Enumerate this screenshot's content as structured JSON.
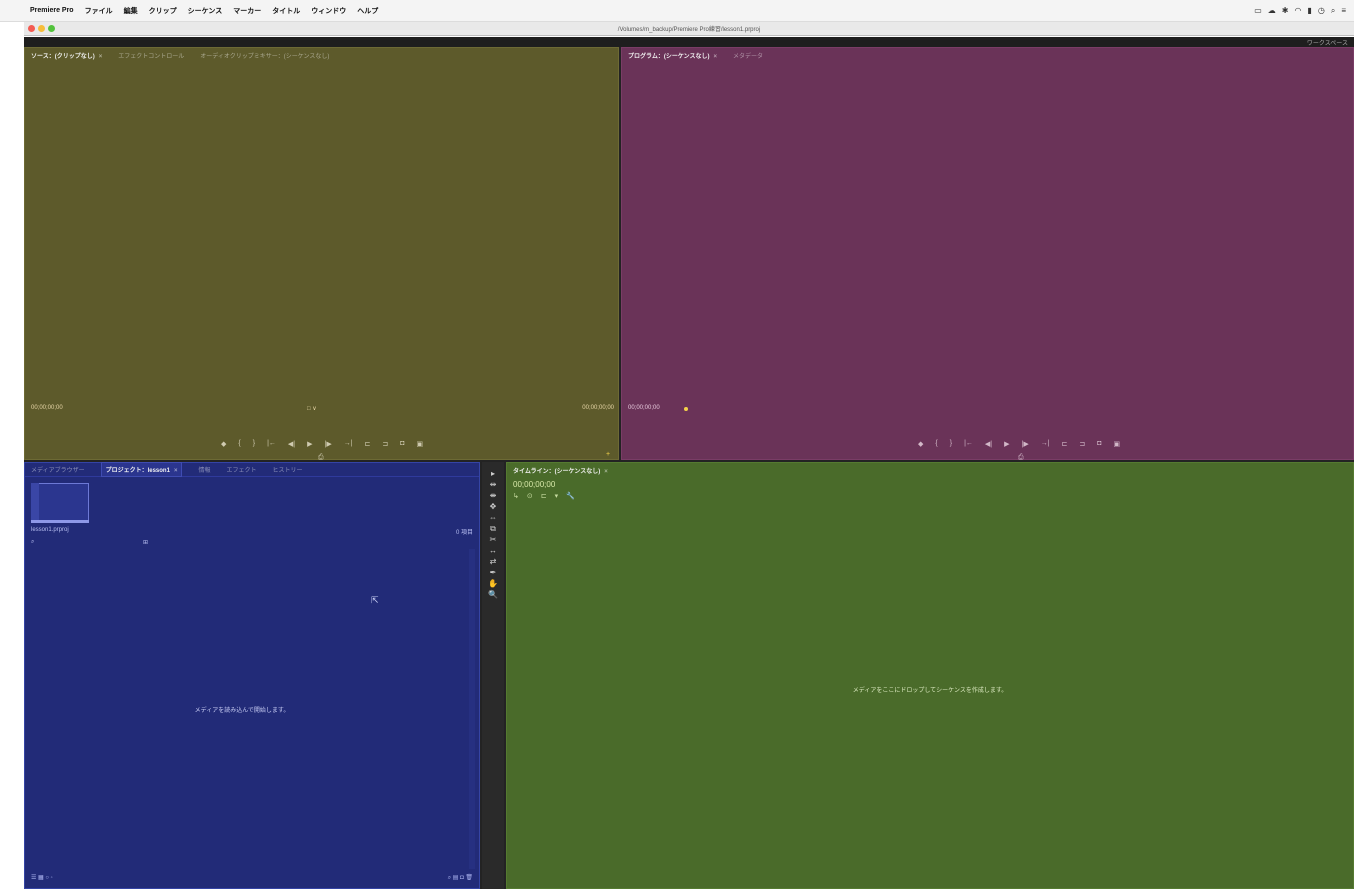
{
  "menubar": {
    "apple": "",
    "app_name": "Premiere Pro",
    "items": [
      "ファイル",
      "編集",
      "クリップ",
      "シーケンス",
      "マーカー",
      "タイトル",
      "ウィンドウ",
      "ヘルプ"
    ],
    "status_icons": [
      "display-icon",
      "cloud-icon",
      "bluetooth-icon",
      "wifi-icon",
      "battery-icon",
      "clock-icon",
      "search-icon",
      "list-icon"
    ]
  },
  "window": {
    "title_path": "/Volumes/m_backup/Premiere Pro練習/lesson1.prproj",
    "workspace_label": "ワークスペース"
  },
  "source_monitor": {
    "tabs": [
      "ソース：(クリップなし)",
      "エフェクトコントロール",
      "オーディオクリップミキサー：(シーケンスなし)"
    ],
    "close_glyph": "×",
    "timecode_left": "00;00;00;00",
    "timecode_right": "00;00;00;00",
    "fit_label": "□ ∨",
    "transport": [
      "◆",
      "{",
      "}",
      "|←",
      "◀|",
      "▶",
      "|▶",
      "→|",
      "⊏",
      "⊐",
      "◘",
      "▣"
    ],
    "export_glyph": "⎙",
    "add_glyph": "+"
  },
  "program_monitor": {
    "tabs": [
      "プログラム：(シーケンスなし)",
      "メタデータ"
    ],
    "close_glyph": "×",
    "timecode_left": "00;00;00;00",
    "transport": [
      "◆",
      "{",
      "}",
      "|←",
      "◀|",
      "▶",
      "|▶",
      "→|",
      "⊏",
      "⊐",
      "◘",
      "▣"
    ],
    "export_glyph": "⎙"
  },
  "project_panel": {
    "tabs": [
      "メディアブラウザー",
      "プロジェクト：lesson1",
      "情報",
      "エフェクト",
      "ヒストリー"
    ],
    "close_glyph": "×",
    "file_name": "lesson1.prproj",
    "item_count": "0 項目",
    "search_glyph": "⌕",
    "filter_glyph": "⊞",
    "empty_message": "メディアを読み込んで開始します。",
    "bottom_left": "☰  ▦  ○  ◦",
    "bottom_right": "⌕  ▤  ◘  🗑"
  },
  "tools": [
    "▸",
    "⇹",
    "⇼",
    "✥",
    "⇔",
    "⧉",
    "✂",
    "↔",
    "⇄",
    "✒",
    "✋",
    "🔍"
  ],
  "timeline": {
    "tab": "タイムライン：(シーケンスなし)",
    "close_glyph": "×",
    "timecode": "00;00;00;00",
    "tool_glyphs": [
      "↳",
      "⊙",
      "⊏",
      "▾",
      "🔧"
    ],
    "empty_message": "メディアをここにドロップしてシーケンスを作成します。"
  }
}
